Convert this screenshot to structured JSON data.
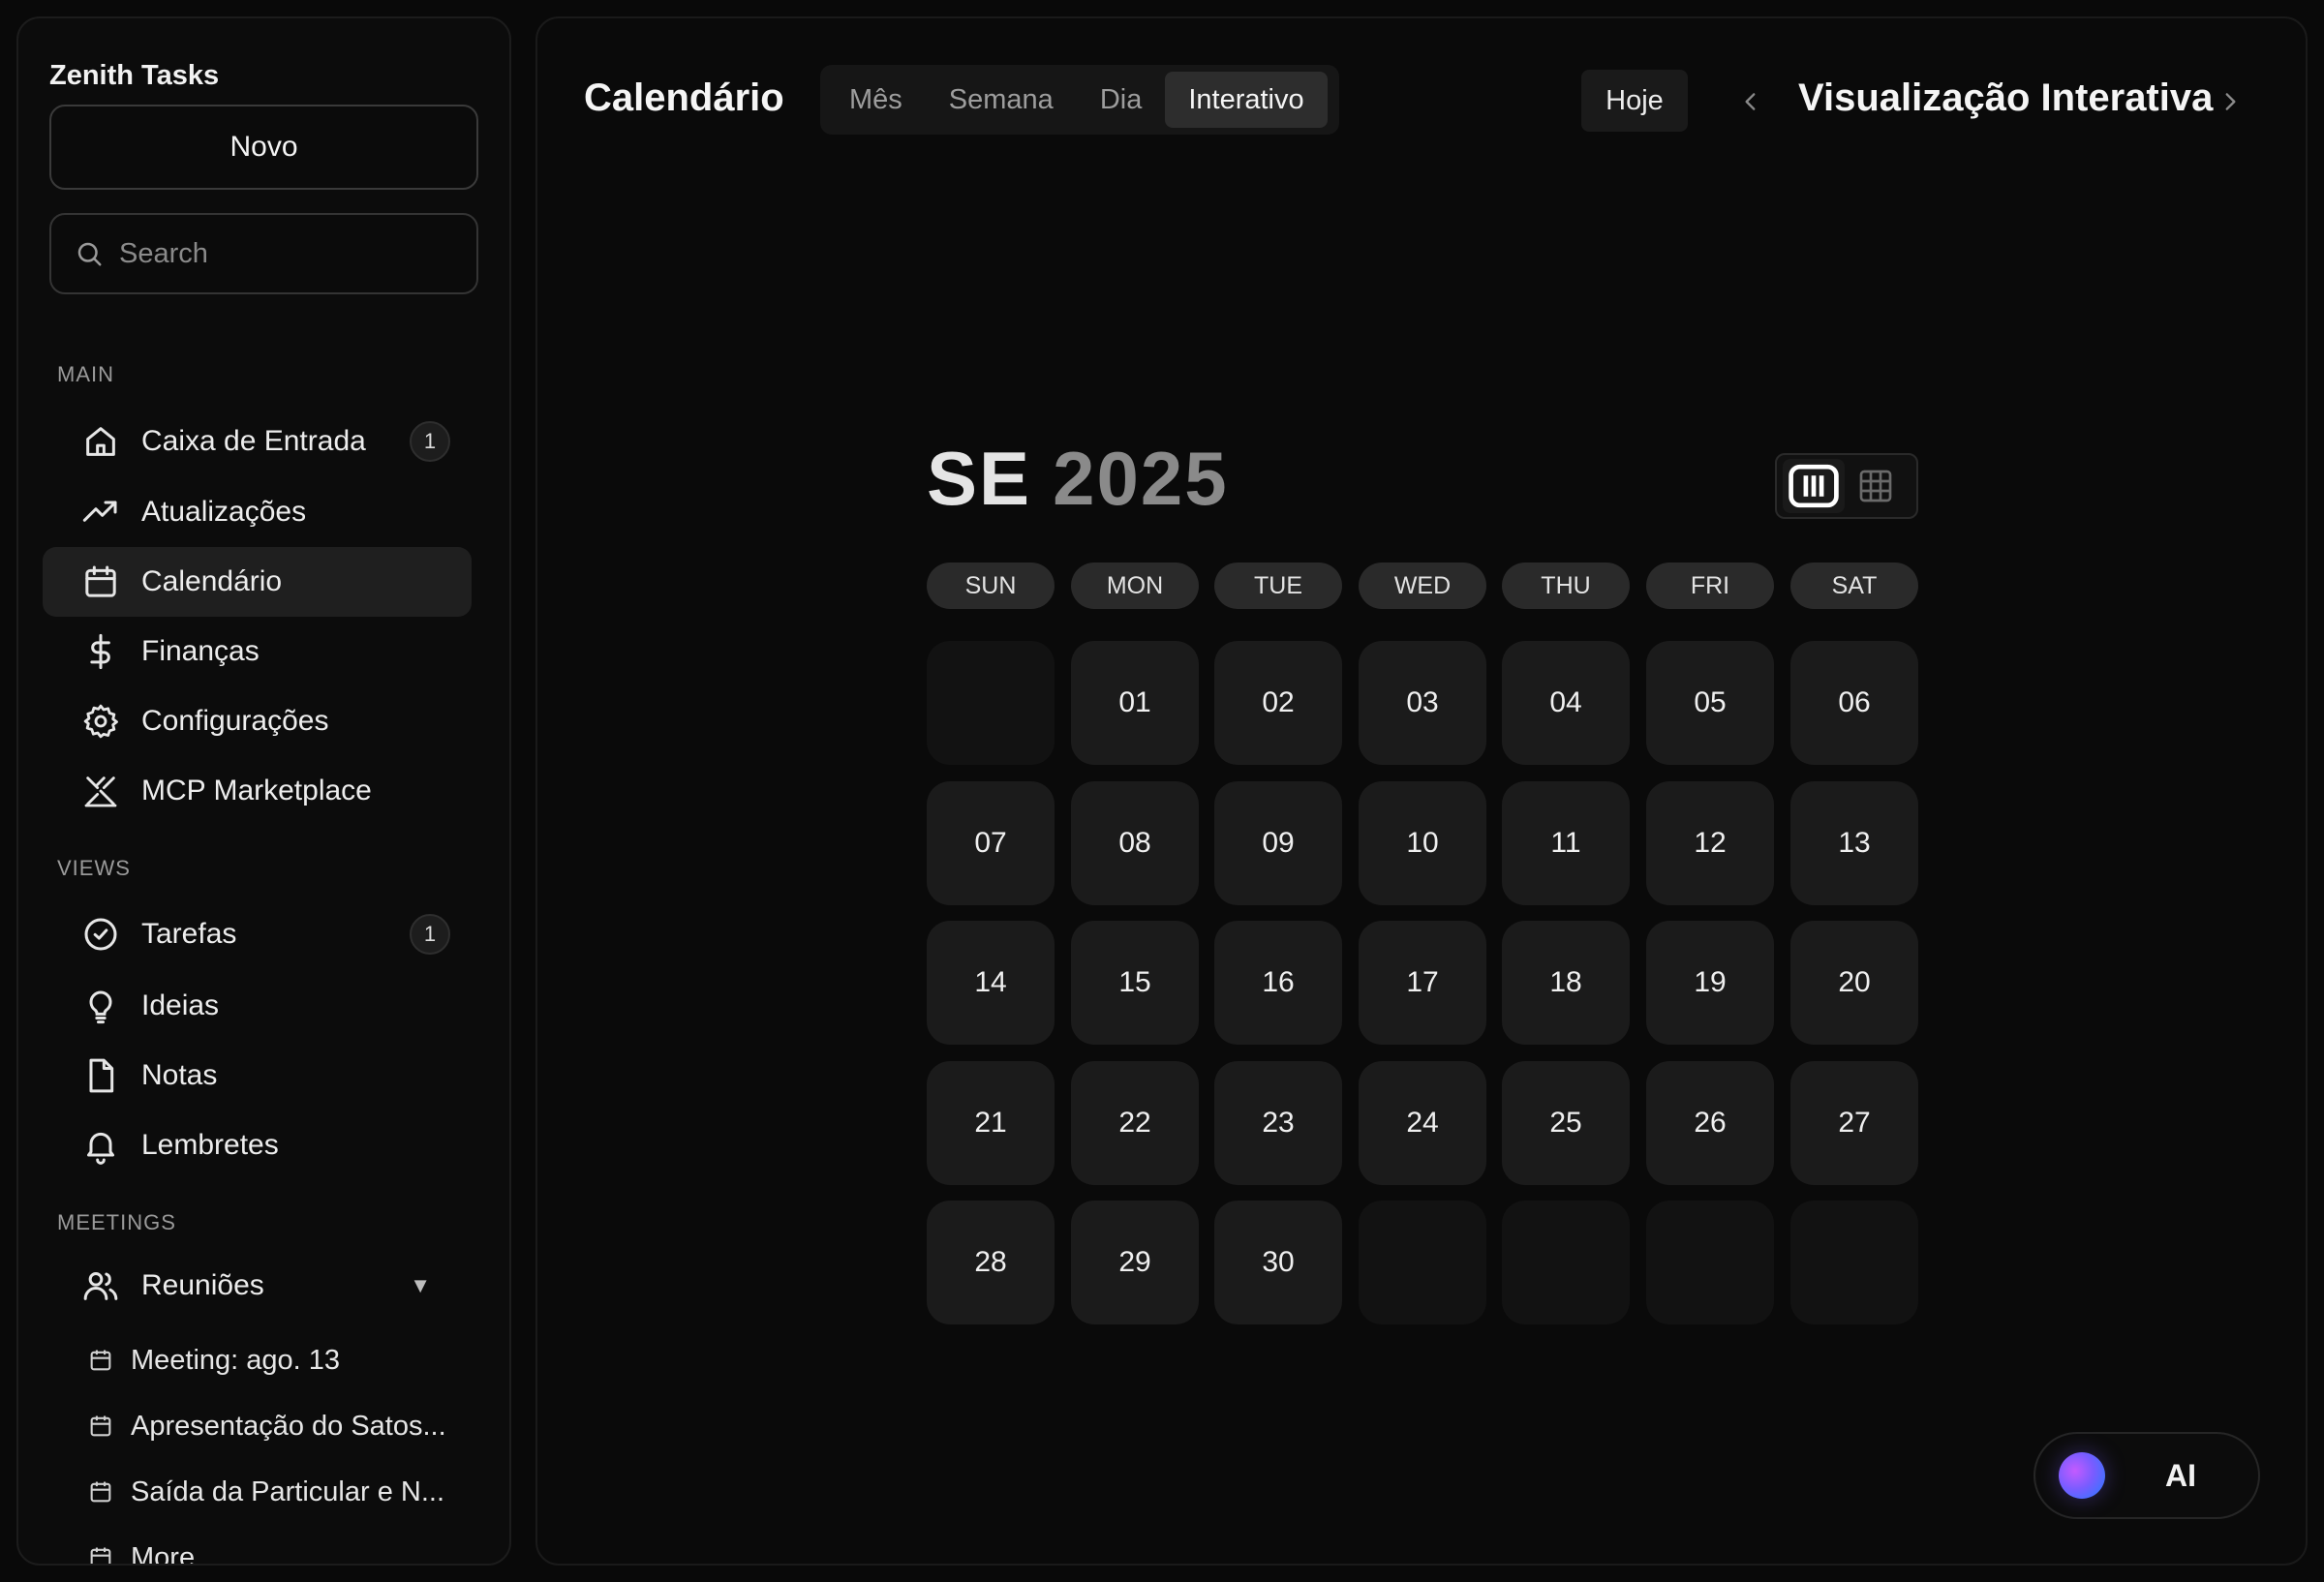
{
  "app": {
    "name": "Zenith Tasks"
  },
  "sidebar": {
    "new_label": "Novo",
    "search_placeholder": "Search",
    "sections": {
      "main": "MAIN",
      "views": "VIEWS",
      "meetings": "MEETINGS"
    },
    "main_items": [
      {
        "label": "Caixa de Entrada",
        "icon": "home-icon",
        "count": "1",
        "active": false
      },
      {
        "label": "Atualizações",
        "icon": "trending-up-icon",
        "active": false
      },
      {
        "label": "Calendário",
        "icon": "calendar-icon",
        "active": true
      },
      {
        "label": "Finanças",
        "icon": "dollar-icon",
        "active": false
      },
      {
        "label": "Configurações",
        "icon": "gear-icon",
        "active": false
      },
      {
        "label": "MCP Marketplace",
        "icon": "marketplace-icon",
        "active": false
      }
    ],
    "view_items": [
      {
        "label": "Tarefas",
        "icon": "check-circle-icon",
        "count": "1"
      },
      {
        "label": "Ideias",
        "icon": "lightbulb-icon"
      },
      {
        "label": "Notas",
        "icon": "file-icon"
      },
      {
        "label": "Lembretes",
        "icon": "bell-icon"
      }
    ],
    "meetings": {
      "group_label": "Reuniões",
      "group_icon": "users-icon",
      "caret": "▼",
      "items": [
        {
          "label": "Meeting: ago. 13"
        },
        {
          "label": "Apresentação do Satos..."
        },
        {
          "label": "Saída da Particular e N..."
        },
        {
          "label": "More"
        }
      ]
    }
  },
  "header": {
    "title": "Calendário",
    "tabs": [
      {
        "label": "Mês",
        "active": false
      },
      {
        "label": "Semana",
        "active": false
      },
      {
        "label": "Dia",
        "active": false
      },
      {
        "label": "Interativo",
        "active": true
      }
    ],
    "today_label": "Hoje",
    "view_title": "Visualização Interativa"
  },
  "calendar": {
    "month_abbr": "SE",
    "year": "2025",
    "weekdays": [
      "SUN",
      "MON",
      "TUE",
      "WED",
      "THU",
      "FRI",
      "SAT"
    ],
    "days": [
      "",
      "01",
      "02",
      "03",
      "04",
      "05",
      "06",
      "07",
      "08",
      "09",
      "10",
      "11",
      "12",
      "13",
      "14",
      "15",
      "16",
      "17",
      "18",
      "19",
      "20",
      "21",
      "22",
      "23",
      "24",
      "25",
      "26",
      "27",
      "28",
      "29",
      "30",
      "",
      "",
      "",
      ""
    ],
    "layout_modes": [
      "columns-icon",
      "grid-icon"
    ],
    "active_layout": "columns-icon"
  },
  "ai_button": {
    "label": "AI"
  },
  "colors": {
    "background": "#090909",
    "panel": "#0a0a0a",
    "cell": "#1b1b1b",
    "cell_empty": "#121212",
    "active_tab": "#2d2d2d",
    "accent_orb": "#7a5cff"
  }
}
